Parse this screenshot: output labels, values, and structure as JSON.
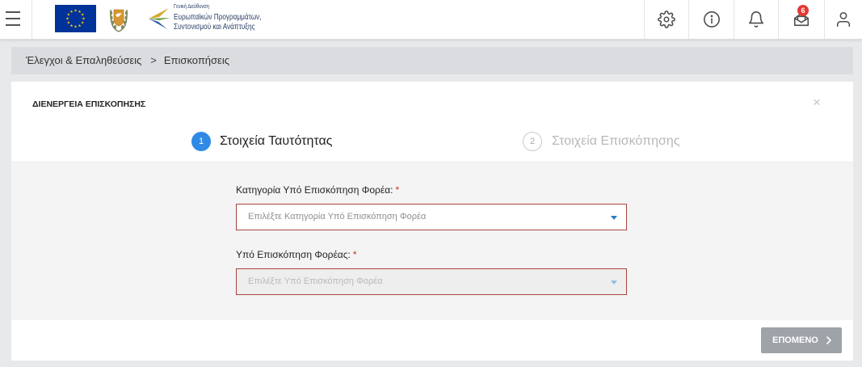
{
  "header": {
    "menu_icon": "hamburger-icon",
    "eu_flag_icon": "eu-flag",
    "coat_of_arms_icon": "cyprus-coat-of-arms",
    "org_logo": {
      "icon": "arrow-logo",
      "lines": [
        "Γενική Διεύθυνση",
        "Ευρωπαϊκών Προγραμμάτων,",
        "Συντονισμού και Ανάπτυξης"
      ]
    },
    "actions": [
      {
        "icon": "gear-icon"
      },
      {
        "icon": "info-icon"
      },
      {
        "icon": "bell-icon"
      },
      {
        "icon": "mail-icon",
        "badge": "6"
      },
      {
        "icon": "user-icon"
      }
    ]
  },
  "breadcrumb": {
    "items": [
      "Έλεγχοι & Επαληθεύσεις",
      "Επισκοπήσεις"
    ],
    "separator": ">"
  },
  "dialog": {
    "title": "ΔΙΕΝΕΡΓΕΙΑ ΕΠΙΣΚΟΠΗΣΗΣ",
    "close": "×",
    "steps": [
      {
        "number": "1",
        "label": "Στοιχεία Ταυτότητας",
        "active": true
      },
      {
        "number": "2",
        "label": "Στοιχεία Επισκόπησης",
        "active": false
      }
    ],
    "fields": [
      {
        "label": "Κατηγορία Υπό Επισκόπηση Φορέα:",
        "required_mark": "*",
        "placeholder": "Επιλέξτε Κατηγορία Υπό Επισκόπηση Φορέα",
        "disabled": false,
        "invalid": true
      },
      {
        "label": "Υπό Επισκόπηση Φορέας:",
        "required_mark": "*",
        "placeholder": "Επιλέξτε Υπό Επισκόπηση Φορέα",
        "disabled": true,
        "invalid": true
      }
    ],
    "next_button": {
      "label": "ΕΠΟΜΕΝΟ",
      "icon": "chevron-right-icon",
      "disabled": true
    }
  },
  "colors": {
    "step_active": "#2f8ae5",
    "invalid_border": "#a94442",
    "required": "#c9302c",
    "caret": "#2b7bc4",
    "next_button": "#9ea3a8",
    "badge": "#e53935",
    "eu_blue": "#003399",
    "eu_gold": "#ffcc00"
  }
}
